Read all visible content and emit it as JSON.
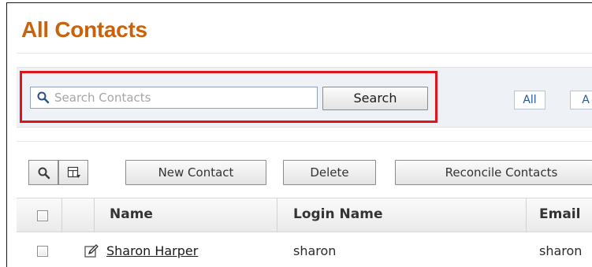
{
  "page": {
    "title": "All Contacts"
  },
  "search": {
    "placeholder": "Search Contacts",
    "value": "",
    "button_label": "Search"
  },
  "alpha_filter": {
    "items": [
      "All",
      "A"
    ]
  },
  "toolbar": {
    "search_icon": "magnifier-icon",
    "columns_icon": "column-settings-icon",
    "new_contact_label": "New Contact",
    "delete_label": "Delete",
    "reconcile_label": "Reconcile Contacts"
  },
  "table": {
    "columns": [
      "Name",
      "Login Name",
      "Email"
    ],
    "rows": [
      {
        "name": "Sharon Harper",
        "login_name": "sharon",
        "email": "sharon"
      }
    ]
  },
  "colors": {
    "title": "#c9620a",
    "highlight_border": "#e0151b",
    "panel_background": "#eef1f6",
    "alpha_link": "#2458a7"
  }
}
